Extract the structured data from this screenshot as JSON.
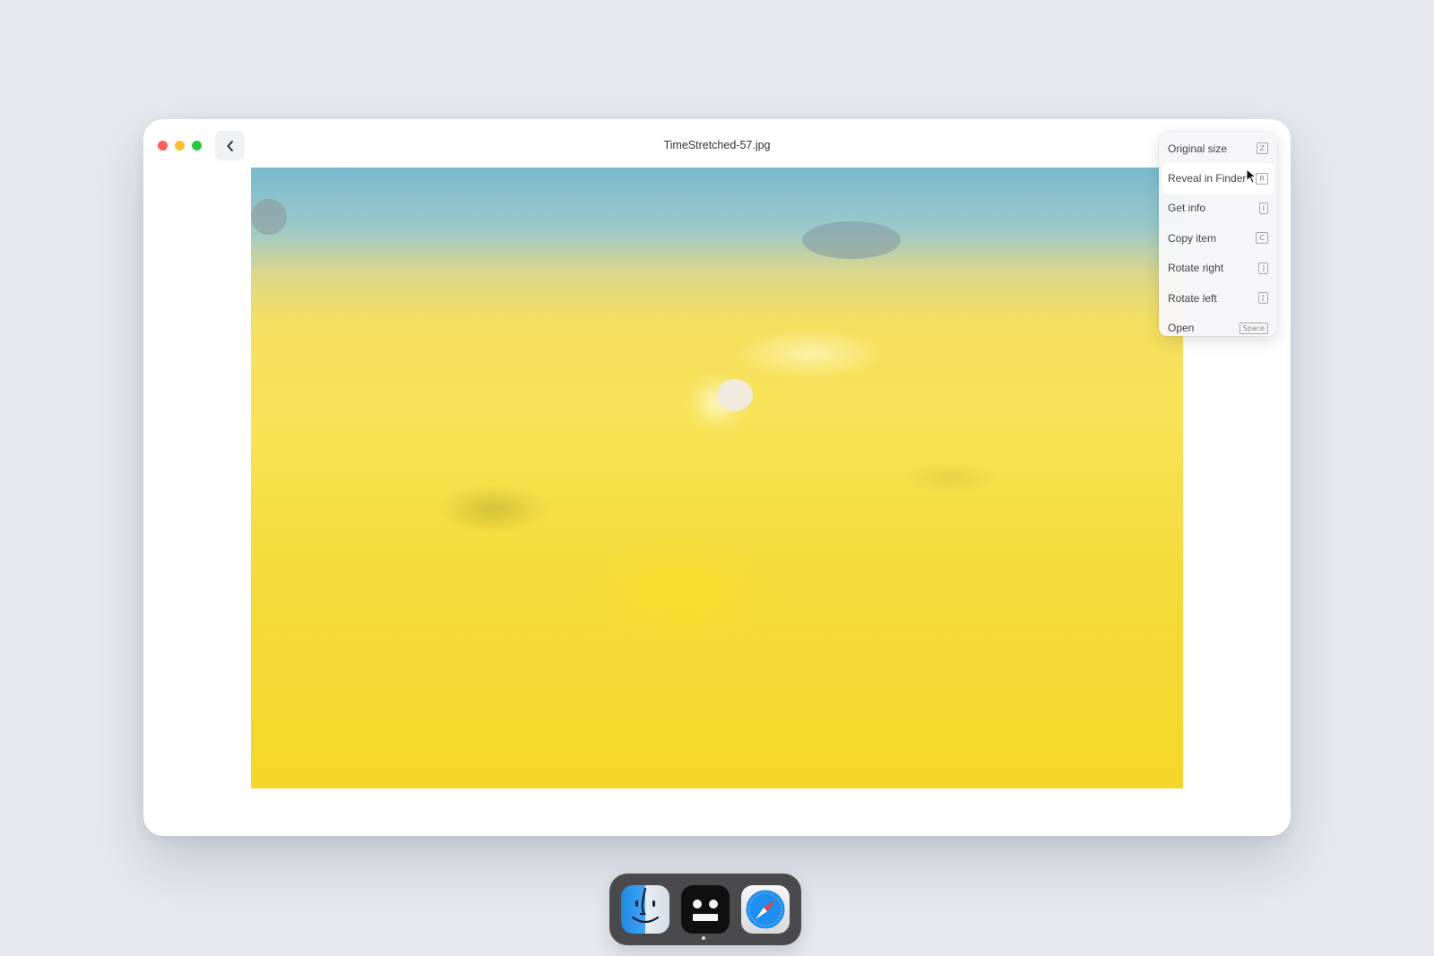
{
  "window": {
    "title": "TimeStretched-57.jpg"
  },
  "context_menu": {
    "items": [
      {
        "label": "Original size",
        "shortcut": "Z"
      },
      {
        "label": "Reveal in Finder",
        "shortcut": "R"
      },
      {
        "label": "Get info",
        "shortcut": "I"
      },
      {
        "label": "Copy item",
        "shortcut": "C"
      },
      {
        "label": "Rotate right",
        "shortcut": "]"
      },
      {
        "label": "Rotate left",
        "shortcut": "["
      },
      {
        "label": "Open",
        "shortcut": "Space"
      }
    ]
  },
  "dock": {
    "apps": [
      "finder-icon",
      "robot-app-icon",
      "safari-icon"
    ]
  }
}
